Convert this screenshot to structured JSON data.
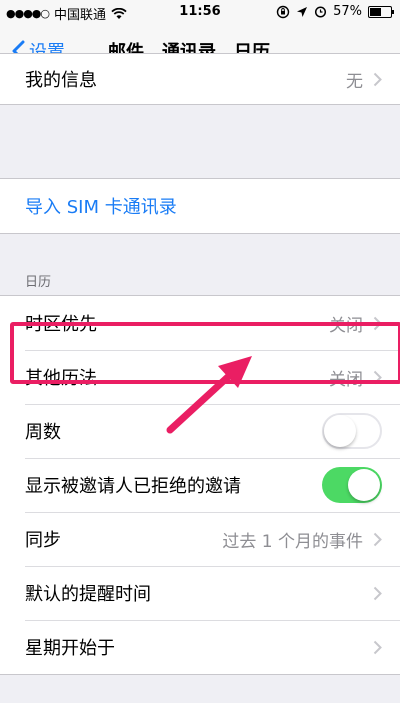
{
  "status_bar": {
    "signal_dots": "●●●●○",
    "carrier": "中国联通",
    "wifi_icon": "wifi-icon",
    "time": "11:56",
    "battery_percent": "57%",
    "battery_level": 0.57
  },
  "nav": {
    "back_label": "设置",
    "title": "邮件、通讯录、日历"
  },
  "rows": {
    "my_info": {
      "label": "我的信息",
      "value": "无"
    },
    "import_sim": {
      "label": "导入 SIM 卡通讯录"
    },
    "section_calendar": "日历",
    "timezone": {
      "label": "时区优先",
      "value": "关闭"
    },
    "alt_calendars": {
      "label": "其他历法",
      "value": "关闭"
    },
    "week_numbers": {
      "label": "周数",
      "on": false
    },
    "show_declined": {
      "label": "显示被邀请人已拒绝的邀请",
      "on": true
    },
    "sync": {
      "label": "同步",
      "value": "过去 1 个月的事件"
    },
    "default_alert": {
      "label": "默认的提醒时间"
    },
    "week_start": {
      "label": "星期开始于"
    }
  },
  "colors": {
    "accent": "#1a7cf5",
    "toggle_on": "#4cd964",
    "annotation": "#ea1e63"
  }
}
